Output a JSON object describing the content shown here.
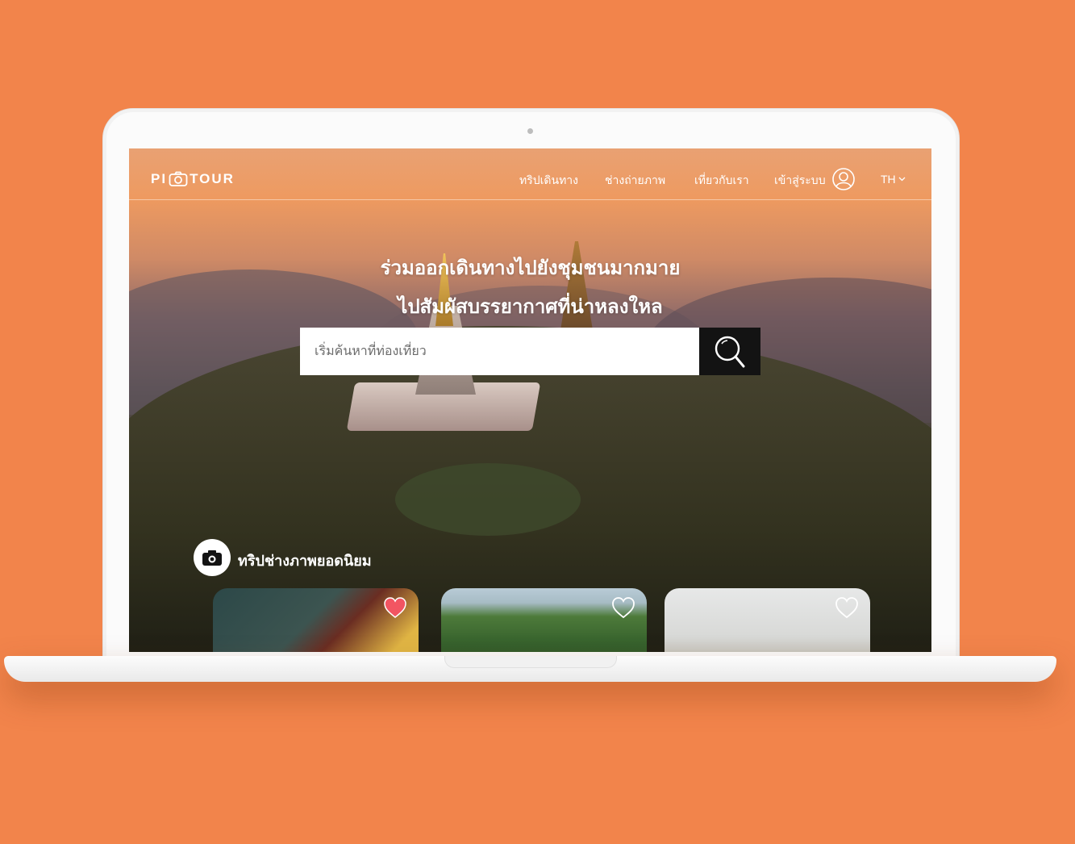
{
  "nav": {
    "logo_left": "PI",
    "logo_right": "TOUR",
    "links": [
      "ทริปเดินทาง",
      "ช่างถ่ายภาพ",
      "เที่ยวกับเรา"
    ],
    "login_label": "เข้าสู่ระบบ",
    "language": "TH"
  },
  "hero": {
    "headline_line1": "ร่วมออกเดินทางไปยังชุมชนมากมาย",
    "headline_line2": "ไปสัมผัสบรรยากาศที่น่าหลงใหล",
    "search_placeholder": "เริ่มค้นหาที่ท่องเที่ยว"
  },
  "section": {
    "title": "ทริปช่างภาพยอดนิยม"
  },
  "cards": [
    {
      "favorited": true
    },
    {
      "favorited": false
    },
    {
      "favorited": false
    }
  ],
  "colors": {
    "background": "#F2844B",
    "heart_active": "#F25562",
    "search_button": "#131313"
  }
}
